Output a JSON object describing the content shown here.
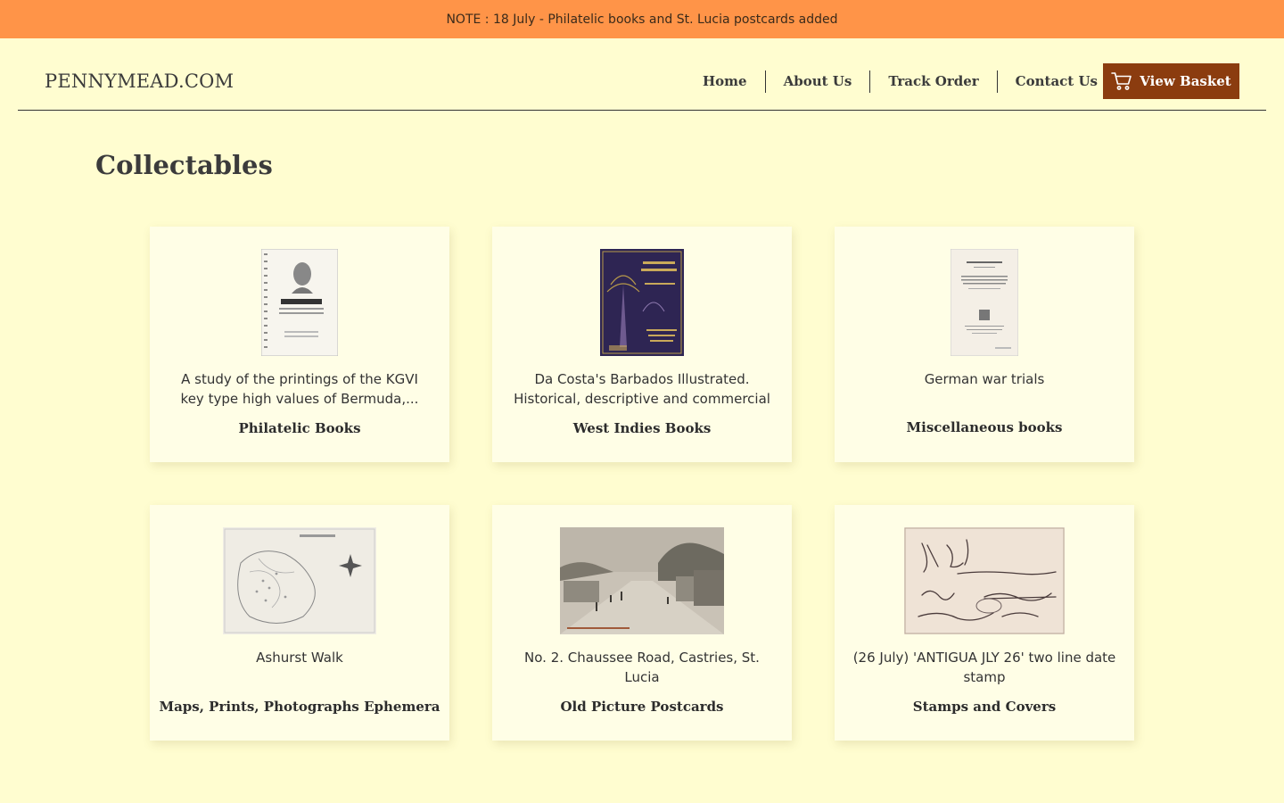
{
  "notice": {
    "text": "NOTE :  18 July - Philatelic books and St. Lucia postcards added"
  },
  "header": {
    "logo": "PENNYMEAD.COM",
    "nav": [
      "Home",
      "About Us",
      "Track Order",
      "Contact Us"
    ],
    "basket_label": "View Basket",
    "basket_icon": "cart-icon",
    "accent": "#8b3c0f"
  },
  "page": {
    "title": "Collectables"
  },
  "cards": [
    {
      "description": "A study of the printings of the KGVI key type high values of Bermuda,...",
      "category": "Philatelic Books",
      "thumbnail": "book-cover-geosix"
    },
    {
      "description": "Da Costa's Barbados Illustrated. Historical, descriptive and commercial",
      "category": "West Indies Books",
      "thumbnail": "book-cover-barbados"
    },
    {
      "description": "German war trials",
      "category": "Miscellaneous books",
      "thumbnail": "book-cover-war-trials"
    },
    {
      "description": "Ashurst Walk",
      "category": "Maps, Prints, Photographs Ephemera",
      "thumbnail": "map-ashurst-walk"
    },
    {
      "description": "No. 2. Chaussee Road, Castries, St. Lucia",
      "category": "Old Picture Postcards",
      "thumbnail": "postcard-street-scene"
    },
    {
      "description": "(26 July) 'ANTIGUA JLY 26' two line date stamp",
      "category": "Stamps and Covers",
      "thumbnail": "postal-cover"
    }
  ],
  "colors": {
    "background": "#fffdd0",
    "notice_bar": "#ff9448",
    "card": "#fffee6"
  }
}
